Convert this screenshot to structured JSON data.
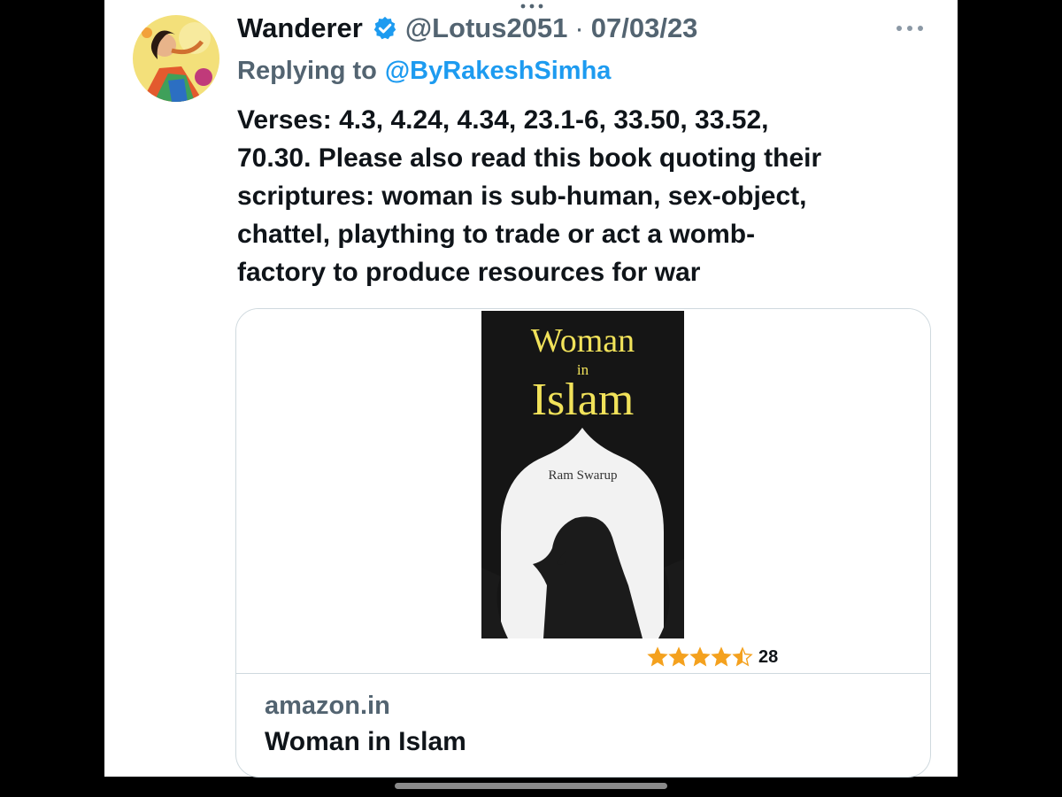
{
  "tweet": {
    "display_name": "Wanderer",
    "verified": true,
    "handle": "@Lotus2051",
    "separator": "·",
    "date": "07/03/23",
    "reply_prefix": "Replying to",
    "reply_to": "@ByRakeshSimha",
    "text_lines": [
      "Verses: 4.3, 4.24, 4.34, 23.1-6, 33.50, 33.52,",
      "70.30. Please also read this book quoting their",
      "scriptures: woman is sub-human, sex-object,",
      "chattel, plaything to trade or act a womb-",
      "factory to produce resources for war"
    ]
  },
  "card": {
    "book_cover": {
      "title_line1": "Woman",
      "title_line2": "in",
      "title_line3": "Islam",
      "author": "Ram Swarup"
    },
    "rating": {
      "stars": 4.5,
      "count": "28"
    },
    "domain": "amazon.in",
    "title": "Woman in Islam"
  },
  "icons": {
    "verified": "verified-badge-icon",
    "more": "more-options-icon",
    "drag_handle": "drag-handle-icon"
  },
  "colors": {
    "accent": "#1d9bf0",
    "secondary_text": "#536471",
    "primary_text": "#0f1419",
    "star": "#f4a11e",
    "book_title": "#f1e25a"
  }
}
